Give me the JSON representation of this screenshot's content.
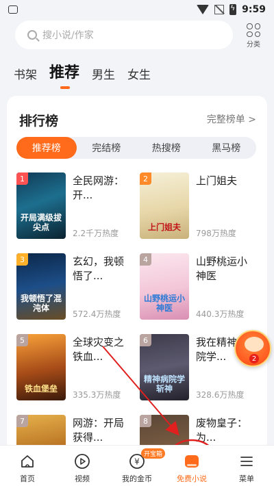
{
  "status_bar": {
    "time": "9:59"
  },
  "search": {
    "placeholder": "搜小说/作家",
    "category_label": "分类"
  },
  "nav_tabs": [
    {
      "label": "书架",
      "active": false
    },
    {
      "label": "推荐",
      "active": true
    },
    {
      "label": "男生",
      "active": false
    },
    {
      "label": "女生",
      "active": false
    }
  ],
  "ranking": {
    "title": "排行榜",
    "more_label": "完整榜单 >",
    "subtabs": [
      "推荐榜",
      "完结榜",
      "热搜榜",
      "黑马榜"
    ],
    "active_subtab": "推荐榜",
    "books": [
      {
        "rank": "1",
        "title": "全民网游：开...",
        "heat": "2.2千万热度",
        "cover_text": "开局满级拔尖点"
      },
      {
        "rank": "2",
        "title": "上门姐夫",
        "heat": "798万热度",
        "cover_text": "上门姐夫"
      },
      {
        "rank": "3",
        "title": "玄幻，我顿悟了...",
        "heat": "572.4万热度",
        "cover_text": "我顿悟了混沌体"
      },
      {
        "rank": "4",
        "title": "山野桃运小神医",
        "heat": "440.3万热度",
        "cover_text": "山野桃运小神医"
      },
      {
        "rank": "5",
        "title": "全球灾变之铁血...",
        "heat": "335.3万热度",
        "cover_text": "铁血堡垒"
      },
      {
        "rank": "6",
        "title": "我在精神病院学...",
        "heat": "328.6万热度",
        "cover_text": "精神病院学斩神"
      },
      {
        "rank": "7",
        "title": "网游：开局获得...",
        "heat": "",
        "cover_text": ""
      },
      {
        "rank": "8",
        "title": "废物皇子：为...",
        "heat": "",
        "cover_text": ""
      }
    ]
  },
  "floating_reward": {
    "count": "2"
  },
  "bottom_nav": [
    {
      "label": "首页",
      "icon": "home-icon",
      "active": false
    },
    {
      "label": "视频",
      "icon": "play-icon",
      "active": false
    },
    {
      "label": "我的金币",
      "icon": "coin-icon",
      "active": false,
      "badge": "开宝箱"
    },
    {
      "label": "免费小说",
      "icon": "book-icon",
      "active": true
    },
    {
      "label": "菜单",
      "icon": "menu-icon",
      "active": false
    }
  ],
  "colors": {
    "accent": "#ff6b1a",
    "annotation": "#e0201e"
  }
}
